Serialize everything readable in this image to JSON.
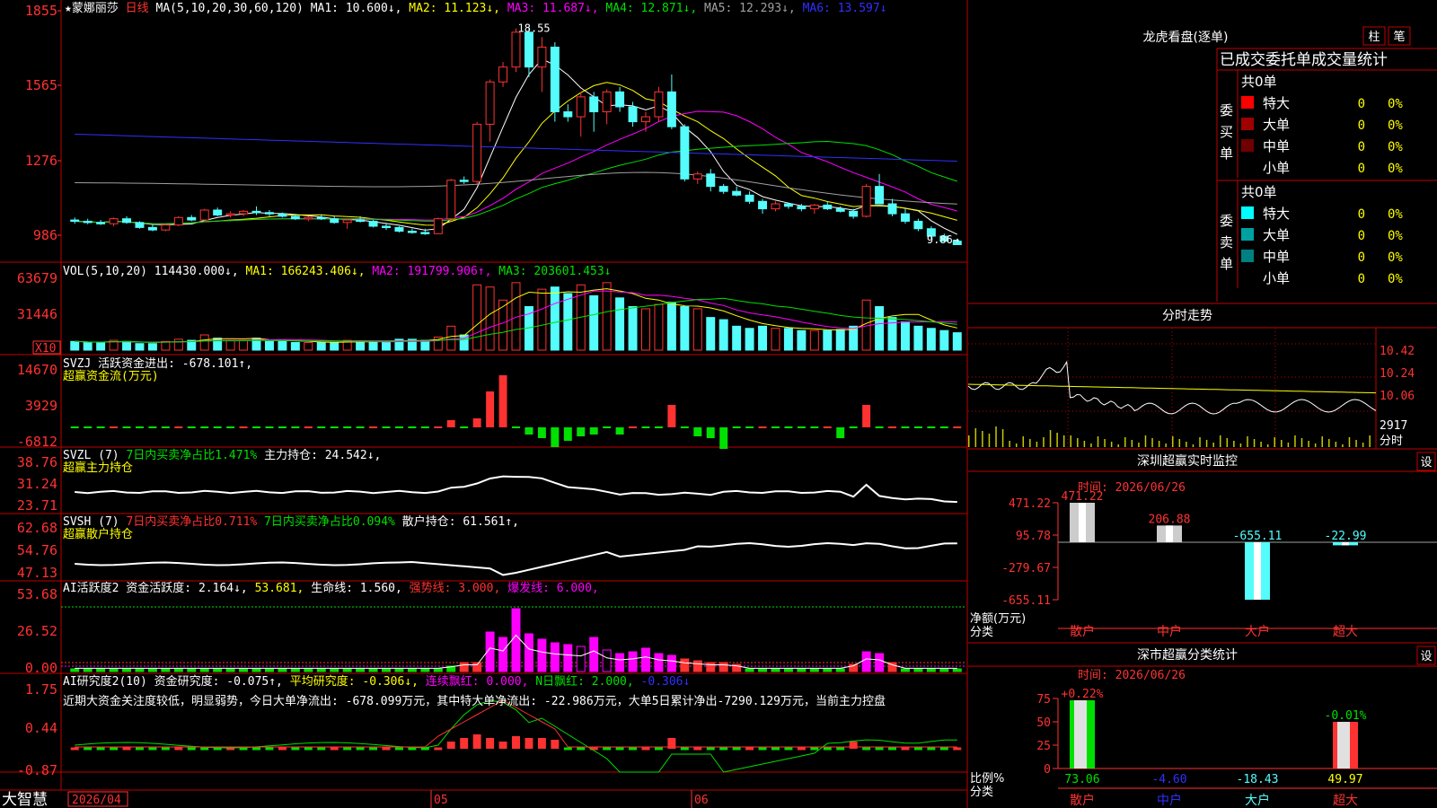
{
  "colors": {
    "up": "#ff3232",
    "down": "#54fcfc",
    "frame": "#c00000",
    "axis": "#ff3232",
    "white": "#ffffff",
    "yellow": "#ffff00",
    "magenta": "#ff00ff",
    "green": "#00e000",
    "blue": "#3030ff",
    "grey": "#a0a0a0",
    "cyan": "#54fcfc"
  },
  "stock": {
    "star": "★",
    "name": "蒙娜丽莎",
    "period": "日线"
  },
  "price_panel": {
    "ma_header": "MA(5,10,20,30,60,120)",
    "ma_items": [
      {
        "label": "MA1: 10.600↓,",
        "color": "#ffffff"
      },
      {
        "label": "MA2: 11.123↓,",
        "color": "#ffff00"
      },
      {
        "label": "MA3: 11.687↓,",
        "color": "#ff00ff"
      },
      {
        "label": "MA4: 12.871↓,",
        "color": "#00e000"
      },
      {
        "label": "MA5: 12.293↓,",
        "color": "#a0a0a0"
      },
      {
        "label": "MA6: 13.597↓",
        "color": "#3030ff"
      }
    ],
    "y_labels": [
      "1855",
      "1565",
      "1276",
      "986"
    ],
    "high_label": "18.55",
    "last_label": "9.86→"
  },
  "vol_panel": {
    "header": "VOL(5,10,20)",
    "items": [
      {
        "label": "114430.000↓,",
        "color": "#ffffff"
      },
      {
        "label": "MA1: 166243.406↓,",
        "color": "#ffff00"
      },
      {
        "label": "MA2: 191799.906↑,",
        "color": "#ff00ff"
      },
      {
        "label": "MA3: 203601.453↓",
        "color": "#00e000"
      }
    ],
    "y_labels": [
      "63679",
      "31446"
    ],
    "unit": "X10"
  },
  "svzj_panel": {
    "line1": [
      {
        "label": "SVZJ  活跃资金进出: -678.101↑,",
        "color": "#ffffff"
      }
    ],
    "line2": "超赢资金流(万元)",
    "y_labels": [
      "14670",
      "3929",
      "-6812"
    ]
  },
  "svzl_panel": {
    "line1": [
      {
        "label": "SVZL (7) ",
        "color": "#ffffff"
      },
      {
        "label": "7日内买卖净占比1.471%",
        "color": "#00e000"
      },
      {
        "label": " 主力持仓: 24.542↓,",
        "color": "#ffffff"
      }
    ],
    "line2": "超赢主力持仓",
    "y_labels": [
      "38.76",
      "31.24",
      "23.71"
    ]
  },
  "svsh_panel": {
    "line1": [
      {
        "label": "SVSH (7) ",
        "color": "#ffffff"
      },
      {
        "label": "7日内买卖净占比0.711%",
        "color": "#ff3232"
      },
      {
        "label": " 7日内买卖净占比0.094%",
        "color": "#00e000"
      },
      {
        "label": " 散户持仓: 61.561↑,",
        "color": "#ffffff"
      }
    ],
    "line2": "超赢散户持仓",
    "y_labels": [
      "62.68",
      "54.76",
      "47.13"
    ]
  },
  "ai1_panel": {
    "line1": [
      {
        "label": "AI活跃度2 资金活跃度: 2.164↓,",
        "color": "#ffffff"
      },
      {
        "label": " 53.681,",
        "color": "#ffff00"
      },
      {
        "label": " 生命线: 1.560,",
        "color": "#ffffff"
      },
      {
        "label": " 强势线: 3.000,",
        "color": "#ff3232"
      },
      {
        "label": " 爆发线: 6.000,",
        "color": "#ff00ff"
      }
    ],
    "y_labels": [
      "53.68",
      "26.52",
      "0.00"
    ]
  },
  "ai2_panel": {
    "line1": [
      {
        "label": "AI研究度2(10) 资金研究度: -0.075↑,",
        "color": "#ffffff"
      },
      {
        "label": " 平均研究度: -0.306↓,",
        "color": "#ffff00"
      },
      {
        "label": " 连续飘红: 0.000,",
        "color": "#ff00ff"
      },
      {
        "label": " N日飘红: 2.000,",
        "color": "#00e000"
      },
      {
        "label": " -0.306↓",
        "color": "#3030ff"
      }
    ],
    "line2": "近期大资金关注度较低，明显弱势，今日大单净流出: -678.099万元，其中特大单净流出: -22.986万元，大单5日累计净出-7290.129万元，当前主力控盘",
    "y_labels": [
      "1.75",
      "0.44",
      "-0.87"
    ]
  },
  "bottom_bar": {
    "brand": "大智慧",
    "date_cursor": "2026/04",
    "months": [
      "05",
      "06"
    ]
  },
  "right_panel": {
    "dragon_tiger_title": "龙虎看盘(逐单)",
    "btn_bar": "柱",
    "btn_pen": "笔",
    "stats_header": "已成交委托单成交量统计",
    "buy_group": {
      "total": "共0单",
      "side_label": "委买单",
      "rows": [
        {
          "label": "特大",
          "count": "0",
          "pct": "0%",
          "color": "#ff0000"
        },
        {
          "label": "大单",
          "count": "0",
          "pct": "0%",
          "color": "#a00000"
        },
        {
          "label": "中单",
          "count": "0",
          "pct": "0%",
          "color": "#700000"
        },
        {
          "label": "小单",
          "count": "0",
          "pct": "0%",
          "color": ""
        }
      ]
    },
    "sell_group": {
      "total": "共0单",
      "side_label": "委卖单",
      "rows": [
        {
          "label": "特大",
          "count": "0",
          "pct": "0%",
          "color": "#00ffff"
        },
        {
          "label": "大单",
          "count": "0",
          "pct": "0%",
          "color": "#00a0a0"
        },
        {
          "label": "中单",
          "count": "0",
          "pct": "0%",
          "color": "#008080"
        },
        {
          "label": "小单",
          "count": "0",
          "pct": "0%",
          "color": ""
        }
      ]
    },
    "intraday": {
      "title": "分时走势",
      "y_labels": [
        "10.42",
        "10.24",
        "10.06"
      ],
      "vol_label": "2917",
      "unit": "分时"
    },
    "monitor": {
      "title": "深圳超赢实时监控",
      "btn": "设",
      "time": "时间: 2026/06/26",
      "y_labels": [
        "471.22",
        "95.78",
        "-279.67",
        "-655.11"
      ],
      "axis_unit": "净额(万元)",
      "axis_class": "分类",
      "categories": [
        "散户",
        "中户",
        "大户",
        "超大"
      ],
      "values": [
        471.22,
        206.88,
        -655.11,
        -22.99
      ],
      "value_labels": [
        "471.22",
        "206.88",
        "-655.11",
        "-22.99"
      ]
    },
    "classify": {
      "title": "深市超赢分类统计",
      "btn": "设",
      "time": "时间: 2026/06/26",
      "y_labels": [
        "75",
        "50",
        "25",
        "0"
      ],
      "axis_unit": "比例%",
      "axis_class": "分类",
      "categories": [
        "散户",
        "中户",
        "大户",
        "超大"
      ],
      "top_labels": [
        "+0.22%",
        "",
        "",
        "-0.01%"
      ],
      "values": [
        73.06,
        -4.6,
        -18.43,
        49.97
      ],
      "bottom_labels": [
        "73.06",
        "-4.60",
        "-18.43",
        "49.97"
      ]
    }
  },
  "chart_data": {
    "type": "candlestick",
    "candles": [
      [
        10.85,
        10.95,
        10.7,
        10.8
      ],
      [
        10.8,
        10.9,
        10.68,
        10.75
      ],
      [
        10.75,
        10.85,
        10.65,
        10.7
      ],
      [
        10.7,
        10.95,
        10.6,
        10.9
      ],
      [
        10.9,
        11.0,
        10.7,
        10.75
      ],
      [
        10.75,
        10.8,
        10.5,
        10.55
      ],
      [
        10.55,
        10.65,
        10.4,
        10.45
      ],
      [
        10.45,
        10.7,
        10.4,
        10.65
      ],
      [
        10.65,
        11.0,
        10.6,
        10.95
      ],
      [
        10.95,
        11.05,
        10.8,
        10.85
      ],
      [
        10.85,
        11.3,
        10.8,
        11.25
      ],
      [
        11.25,
        11.35,
        11.0,
        11.05
      ],
      [
        11.05,
        11.2,
        10.95,
        11.1
      ],
      [
        11.1,
        11.25,
        11.0,
        11.2
      ],
      [
        11.2,
        11.4,
        11.05,
        11.15
      ],
      [
        11.15,
        11.25,
        11.0,
        11.1
      ],
      [
        11.1,
        11.15,
        10.95,
        11.0
      ],
      [
        11.0,
        11.1,
        10.85,
        10.9
      ],
      [
        10.9,
        11.0,
        10.8,
        10.95
      ],
      [
        10.95,
        11.05,
        10.85,
        10.9
      ],
      [
        10.9,
        11.0,
        10.7,
        10.75
      ],
      [
        10.75,
        10.9,
        10.5,
        10.85
      ],
      [
        10.85,
        11.0,
        10.75,
        10.8
      ],
      [
        10.8,
        10.85,
        10.55,
        10.6
      ],
      [
        10.6,
        10.7,
        10.45,
        10.55
      ],
      [
        10.55,
        10.6,
        10.35,
        10.4
      ],
      [
        10.4,
        10.5,
        10.3,
        10.35
      ],
      [
        10.35,
        10.5,
        10.25,
        10.3
      ],
      [
        10.3,
        10.95,
        10.3,
        10.9
      ],
      [
        10.9,
        12.5,
        10.8,
        12.45
      ],
      [
        12.45,
        12.6,
        12.3,
        12.4
      ],
      [
        12.4,
        14.8,
        12.3,
        14.7
      ],
      [
        14.7,
        16.5,
        14.0,
        16.4
      ],
      [
        16.4,
        17.2,
        16.2,
        17.0
      ],
      [
        17.0,
        18.55,
        16.8,
        18.4
      ],
      [
        18.4,
        18.6,
        16.6,
        17.0
      ],
      [
        17.0,
        18.2,
        16.0,
        17.8
      ],
      [
        17.8,
        18.0,
        14.8,
        15.2
      ],
      [
        15.2,
        15.5,
        14.8,
        15.0
      ],
      [
        15.0,
        16.0,
        14.2,
        15.8
      ],
      [
        15.8,
        16.0,
        14.4,
        15.2
      ],
      [
        15.2,
        16.1,
        14.7,
        16.0
      ],
      [
        16.0,
        16.2,
        15.2,
        15.4
      ],
      [
        15.4,
        15.6,
        14.6,
        14.8
      ],
      [
        14.8,
        15.2,
        14.4,
        15.0
      ],
      [
        15.0,
        16.2,
        14.8,
        16.0
      ],
      [
        16.0,
        16.7,
        14.5,
        14.6
      ],
      [
        14.6,
        14.7,
        12.4,
        12.5
      ],
      [
        12.5,
        12.8,
        12.3,
        12.7
      ],
      [
        12.7,
        12.9,
        12.0,
        12.2
      ],
      [
        12.2,
        12.3,
        11.9,
        12.0
      ],
      [
        12.0,
        12.2,
        11.8,
        11.85
      ],
      [
        11.85,
        12.0,
        11.5,
        11.6
      ],
      [
        11.6,
        11.7,
        11.1,
        11.3
      ],
      [
        11.3,
        11.6,
        11.2,
        11.5
      ],
      [
        11.5,
        11.55,
        11.3,
        11.4
      ],
      [
        11.4,
        11.5,
        11.2,
        11.3
      ],
      [
        11.3,
        11.5,
        11.1,
        11.45
      ],
      [
        11.45,
        11.6,
        11.25,
        11.3
      ],
      [
        11.3,
        11.4,
        11.15,
        11.2
      ],
      [
        11.2,
        11.3,
        10.9,
        11.0
      ],
      [
        11.0,
        12.3,
        10.95,
        12.2
      ],
      [
        12.2,
        12.7,
        11.9,
        11.5
      ],
      [
        11.5,
        11.7,
        11.0,
        11.1
      ],
      [
        11.1,
        11.3,
        10.7,
        10.8
      ],
      [
        10.8,
        10.9,
        10.4,
        10.5
      ],
      [
        10.5,
        10.6,
        10.1,
        10.2
      ],
      [
        10.2,
        10.3,
        9.95,
        10.0
      ],
      [
        10.0,
        10.1,
        9.86,
        9.86
      ]
    ]
  }
}
